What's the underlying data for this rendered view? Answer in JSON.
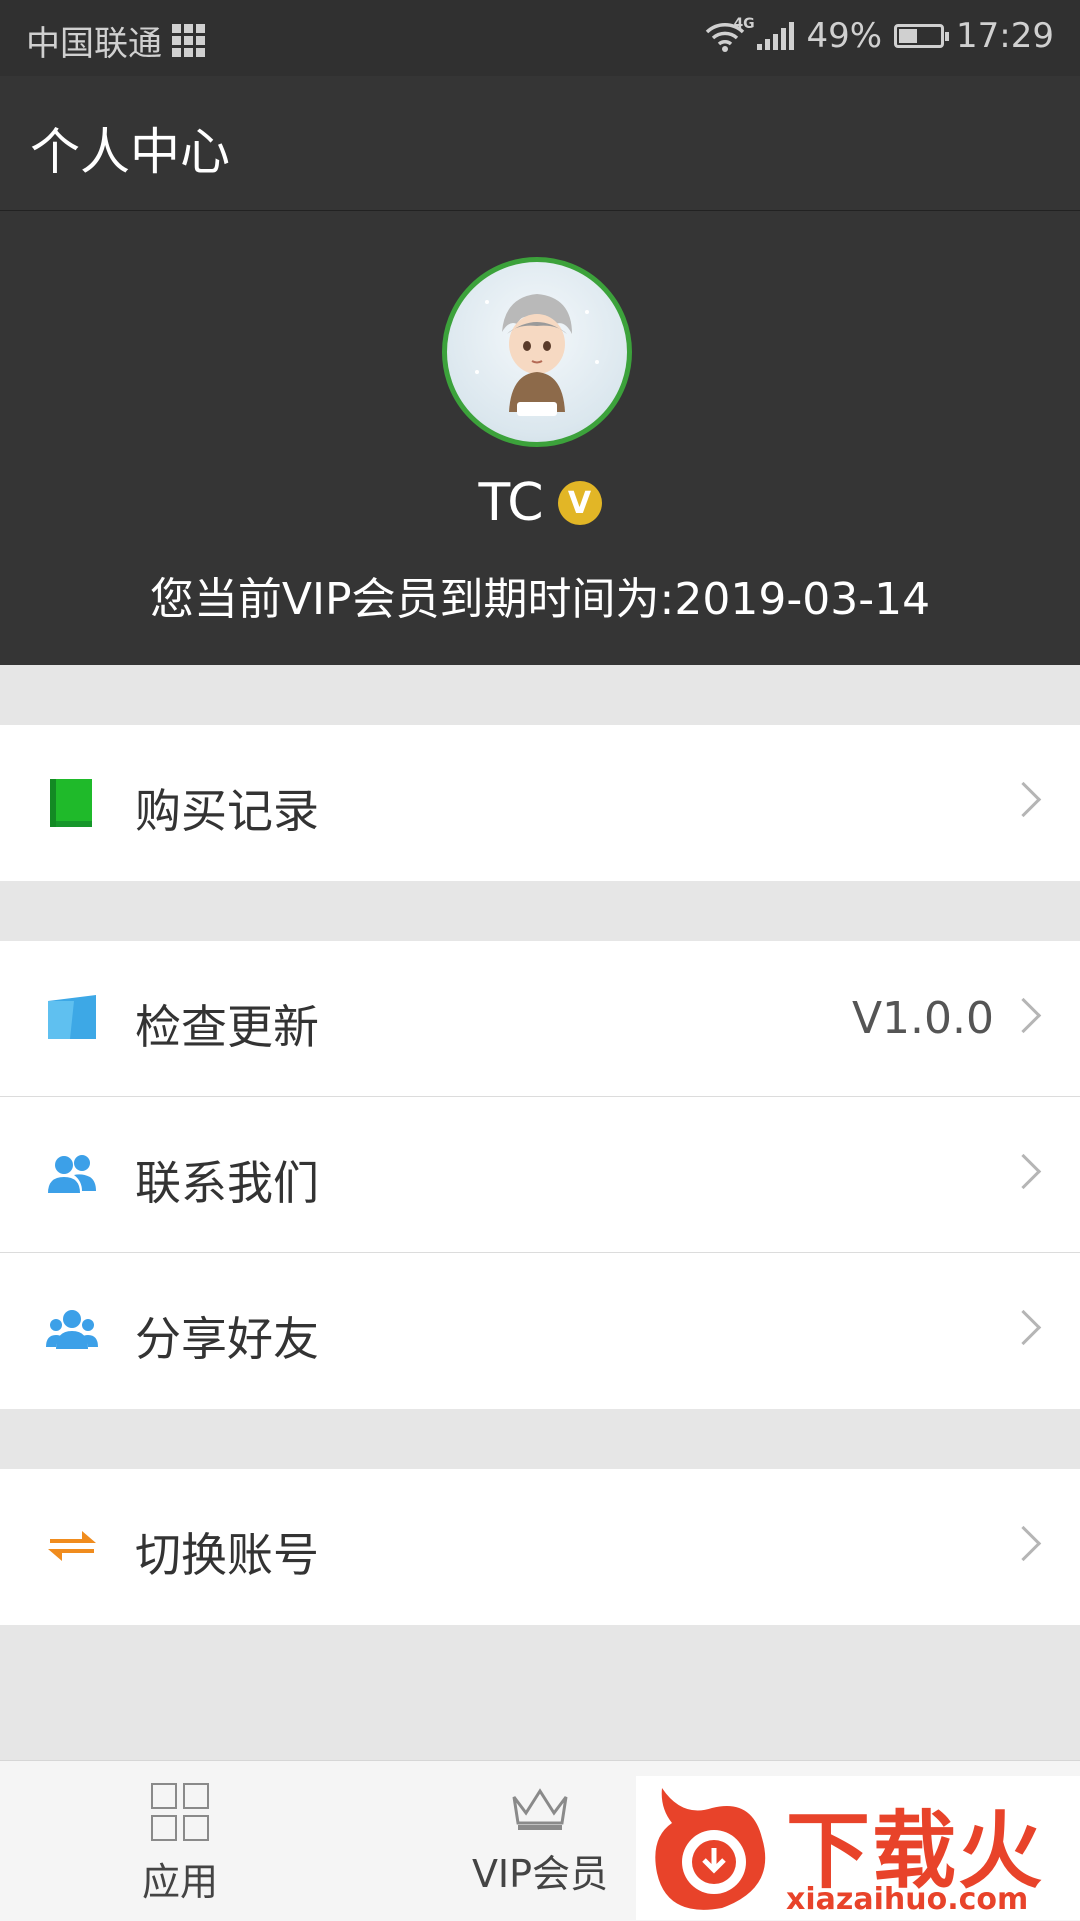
{
  "status_bar": {
    "carrier": "中国联通",
    "network": "4G",
    "battery": "49%",
    "time": "17:29"
  },
  "header": {
    "title": "个人中心"
  },
  "profile": {
    "username": "TC",
    "vip_badge": "V",
    "expiry_text": "您当前VIP会员到期时间为:2019-03-14"
  },
  "menu": {
    "purchase_records": {
      "label": "购买记录",
      "icon": "book-icon",
      "color": "#1fba2a"
    },
    "check_update": {
      "label": "检查更新",
      "value": "V1.0.0",
      "icon": "folder-icon",
      "color": "#3da8e6"
    },
    "contact_us": {
      "label": "联系我们",
      "icon": "people-icon",
      "color": "#3ca0e8"
    },
    "share_friends": {
      "label": "分享好友",
      "icon": "group-icon",
      "color": "#3ca0e8"
    },
    "switch_account": {
      "label": "切换账号",
      "icon": "swap-arrows-icon",
      "color": "#f08c1e"
    }
  },
  "bottom_nav": {
    "apps": {
      "label": "应用",
      "icon": "grid-icon"
    },
    "vip": {
      "label": "VIP会员",
      "icon": "crown-icon"
    }
  },
  "watermark": {
    "text": "下载火",
    "url": "xiazaihuo.com"
  },
  "colors": {
    "header_bg": "#353535",
    "avatar_border": "#3ca23b",
    "accent": "#e8432a"
  }
}
